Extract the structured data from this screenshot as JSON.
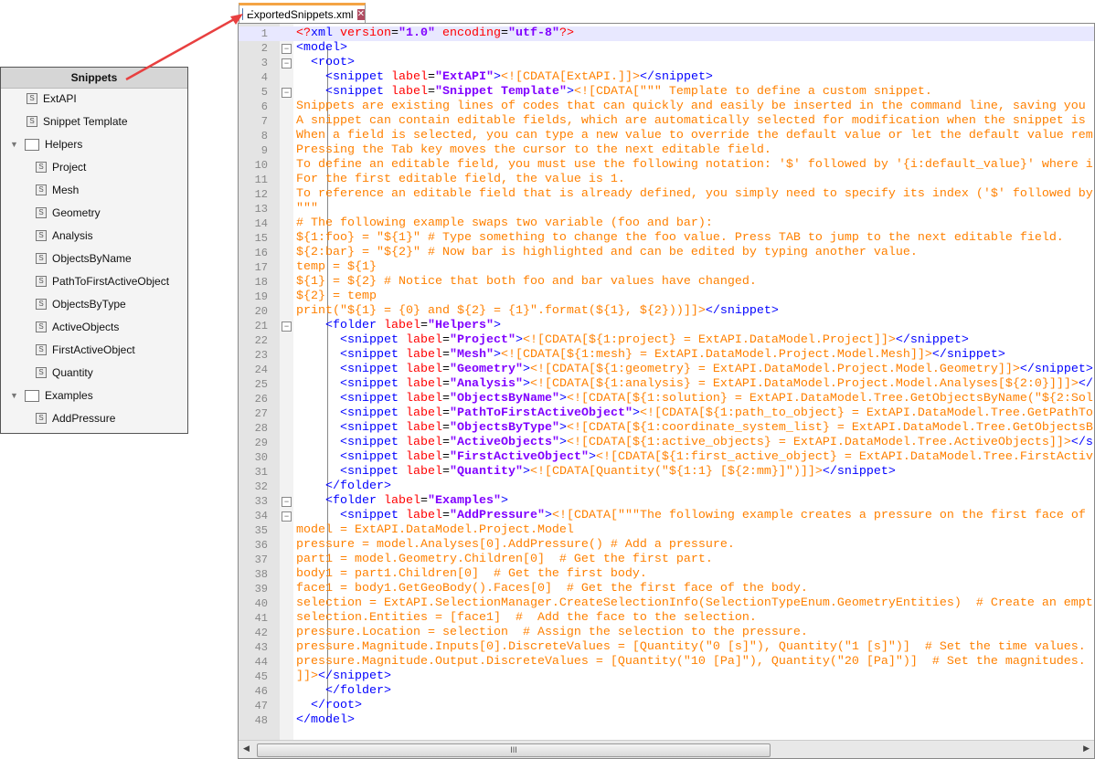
{
  "tree": {
    "title": "Snippets",
    "items": [
      {
        "label": "ExtAPI",
        "type": "snippet",
        "level": 1
      },
      {
        "label": "Snippet Template",
        "type": "snippet",
        "level": 1
      },
      {
        "label": "Helpers",
        "type": "folder",
        "level": 0
      },
      {
        "label": "Project",
        "type": "snippet",
        "level": 2
      },
      {
        "label": "Mesh",
        "type": "snippet",
        "level": 2
      },
      {
        "label": "Geometry",
        "type": "snippet",
        "level": 2
      },
      {
        "label": "Analysis",
        "type": "snippet",
        "level": 2
      },
      {
        "label": "ObjectsByName",
        "type": "snippet",
        "level": 2
      },
      {
        "label": "PathToFirstActiveObject",
        "type": "snippet",
        "level": 2
      },
      {
        "label": "ObjectsByType",
        "type": "snippet",
        "level": 2
      },
      {
        "label": "ActiveObjects",
        "type": "snippet",
        "level": 2
      },
      {
        "label": "FirstActiveObject",
        "type": "snippet",
        "level": 2
      },
      {
        "label": "Quantity",
        "type": "snippet",
        "level": 2
      },
      {
        "label": "Examples",
        "type": "folder",
        "level": 0
      },
      {
        "label": "AddPressure",
        "type": "snippet",
        "level": 2
      }
    ],
    "snippet_icon_letter": "S"
  },
  "tab": {
    "label": "ExportedSnippets.xml",
    "close": "✕"
  },
  "scroll_grip": "III",
  "code_lines": [
    [
      [
        "pi",
        "<?"
      ],
      [
        "tag",
        "xml "
      ],
      [
        "attr",
        "version"
      ],
      [
        "eq",
        "="
      ],
      [
        "val",
        "\"1.0\" "
      ],
      [
        "attr",
        "encoding"
      ],
      [
        "eq",
        "="
      ],
      [
        "val",
        "\"utf-8\""
      ],
      [
        "pi",
        "?>"
      ]
    ],
    [
      [
        "tag",
        "<model>"
      ]
    ],
    [
      [
        "tag",
        "  <root>"
      ]
    ],
    [
      [
        "tag",
        "    <snippet "
      ],
      [
        "attr",
        "label"
      ],
      [
        "eq",
        "="
      ],
      [
        "val",
        "\"ExtAPI\""
      ],
      [
        "tag",
        ">"
      ],
      [
        "cd",
        "<![CDATA[ExtAPI.]]>"
      ],
      [
        "tag",
        "</snippet>"
      ]
    ],
    [
      [
        "tag",
        "    <snippet "
      ],
      [
        "attr",
        "label"
      ],
      [
        "eq",
        "="
      ],
      [
        "val",
        "\"Snippet Template\""
      ],
      [
        "tag",
        ">"
      ],
      [
        "cd",
        "<![CDATA[\"\"\" Template to define a custom snippet."
      ]
    ],
    [
      [
        "cd",
        "Snippets are existing lines of codes that can quickly and easily be inserted in the command line, saving you"
      ]
    ],
    [
      [
        "cd",
        "A snippet can contain editable fields, which are automatically selected for modification when the snippet is"
      ]
    ],
    [
      [
        "cd",
        "When a field is selected, you can type a new value to override the default value or let the default value rem"
      ]
    ],
    [
      [
        "cd",
        "Pressing the Tab key moves the cursor to the next editable field."
      ]
    ],
    [
      [
        "cd",
        "To define an editable field, you must use the following notation: '$' followed by '{i:default_value}' where i"
      ]
    ],
    [
      [
        "cd",
        "For the first editable field, the value is 1."
      ]
    ],
    [
      [
        "cd",
        "To reference an editable field that is already defined, you simply need to specify its index ('$' followed by"
      ]
    ],
    [
      [
        "cd",
        "\"\"\""
      ]
    ],
    [
      [
        "cd",
        "# The following example swaps two variable (foo and bar):"
      ]
    ],
    [
      [
        "cd",
        "${1:foo} = \"${1}\" # Type something to change the foo value. Press TAB to jump to the next editable field."
      ]
    ],
    [
      [
        "cd",
        "${2:bar} = \"${2}\" # Now bar is highlighted and can be edited by typing another value."
      ]
    ],
    [
      [
        "cd",
        "temp = ${1}"
      ]
    ],
    [
      [
        "cd",
        "${1} = ${2} # Notice that both foo and bar values have changed."
      ]
    ],
    [
      [
        "cd",
        "${2} = temp"
      ]
    ],
    [
      [
        "cd",
        "print(\"${1} = {0} and ${2} = {1}\".format(${1}, ${2}))]]>"
      ],
      [
        "tag",
        "</snippet>"
      ]
    ],
    [
      [
        "tag",
        "    <folder "
      ],
      [
        "attr",
        "label"
      ],
      [
        "eq",
        "="
      ],
      [
        "val",
        "\"Helpers\""
      ],
      [
        "tag",
        ">"
      ]
    ],
    [
      [
        "tag",
        "      <snippet "
      ],
      [
        "attr",
        "label"
      ],
      [
        "eq",
        "="
      ],
      [
        "val",
        "\"Project\""
      ],
      [
        "tag",
        ">"
      ],
      [
        "cd",
        "<![CDATA[${1:project} = ExtAPI.DataModel.Project]]>"
      ],
      [
        "tag",
        "</snippet>"
      ]
    ],
    [
      [
        "tag",
        "      <snippet "
      ],
      [
        "attr",
        "label"
      ],
      [
        "eq",
        "="
      ],
      [
        "val",
        "\"Mesh\""
      ],
      [
        "tag",
        ">"
      ],
      [
        "cd",
        "<![CDATA[${1:mesh} = ExtAPI.DataModel.Project.Model.Mesh]]>"
      ],
      [
        "tag",
        "</snippet>"
      ]
    ],
    [
      [
        "tag",
        "      <snippet "
      ],
      [
        "attr",
        "label"
      ],
      [
        "eq",
        "="
      ],
      [
        "val",
        "\"Geometry\""
      ],
      [
        "tag",
        ">"
      ],
      [
        "cd",
        "<![CDATA[${1:geometry} = ExtAPI.DataModel.Project.Model.Geometry]]>"
      ],
      [
        "tag",
        "</snippet>"
      ]
    ],
    [
      [
        "tag",
        "      <snippet "
      ],
      [
        "attr",
        "label"
      ],
      [
        "eq",
        "="
      ],
      [
        "val",
        "\"Analysis\""
      ],
      [
        "tag",
        ">"
      ],
      [
        "cd",
        "<![CDATA[${1:analysis} = ExtAPI.DataModel.Project.Model.Analyses[${2:0}]]]>"
      ],
      [
        "tag",
        "</snippet>"
      ]
    ],
    [
      [
        "tag",
        "      <snippet "
      ],
      [
        "attr",
        "label"
      ],
      [
        "eq",
        "="
      ],
      [
        "val",
        "\"ObjectsByName\""
      ],
      [
        "tag",
        ">"
      ],
      [
        "cd",
        "<![CDATA[${1:solution} = ExtAPI.DataModel.Tree.GetObjectsByName(\"${2:Sol"
      ]
    ],
    [
      [
        "tag",
        "      <snippet "
      ],
      [
        "attr",
        "label"
      ],
      [
        "eq",
        "="
      ],
      [
        "val",
        "\"PathToFirstActiveObject\""
      ],
      [
        "tag",
        ">"
      ],
      [
        "cd",
        "<![CDATA[${1:path_to_object} = ExtAPI.DataModel.Tree.GetPathTo"
      ]
    ],
    [
      [
        "tag",
        "      <snippet "
      ],
      [
        "attr",
        "label"
      ],
      [
        "eq",
        "="
      ],
      [
        "val",
        "\"ObjectsByType\""
      ],
      [
        "tag",
        ">"
      ],
      [
        "cd",
        "<![CDATA[${1:coordinate_system_list} = ExtAPI.DataModel.Tree.GetObjectsB"
      ]
    ],
    [
      [
        "tag",
        "      <snippet "
      ],
      [
        "attr",
        "label"
      ],
      [
        "eq",
        "="
      ],
      [
        "val",
        "\"ActiveObjects\""
      ],
      [
        "tag",
        ">"
      ],
      [
        "cd",
        "<![CDATA[${1:active_objects} = ExtAPI.DataModel.Tree.ActiveObjects]]>"
      ],
      [
        "tag",
        "</snippet>"
      ]
    ],
    [
      [
        "tag",
        "      <snippet "
      ],
      [
        "attr",
        "label"
      ],
      [
        "eq",
        "="
      ],
      [
        "val",
        "\"FirstActiveObject\""
      ],
      [
        "tag",
        ">"
      ],
      [
        "cd",
        "<![CDATA[${1:first_active_object} = ExtAPI.DataModel.Tree.FirstActiv"
      ]
    ],
    [
      [
        "tag",
        "      <snippet "
      ],
      [
        "attr",
        "label"
      ],
      [
        "eq",
        "="
      ],
      [
        "val",
        "\"Quantity\""
      ],
      [
        "tag",
        ">"
      ],
      [
        "cd",
        "<![CDATA[Quantity(\"${1:1} [${2:mm}]\")]]>"
      ],
      [
        "tag",
        "</snippet>"
      ]
    ],
    [
      [
        "tag",
        "    </folder>"
      ]
    ],
    [
      [
        "tag",
        "    <folder "
      ],
      [
        "attr",
        "label"
      ],
      [
        "eq",
        "="
      ],
      [
        "val",
        "\"Examples\""
      ],
      [
        "tag",
        ">"
      ]
    ],
    [
      [
        "tag",
        "      <snippet "
      ],
      [
        "attr",
        "label"
      ],
      [
        "eq",
        "="
      ],
      [
        "val",
        "\"AddPressure\""
      ],
      [
        "tag",
        ">"
      ],
      [
        "cd",
        "<![CDATA[\"\"\"The following example creates a pressure on the first face of"
      ]
    ],
    [
      [
        "cd",
        "model = ExtAPI.DataModel.Project.Model"
      ]
    ],
    [
      [
        "cd",
        "pressure = model.Analyses[0].AddPressure() # Add a pressure."
      ]
    ],
    [
      [
        "cd",
        "part1 = model.Geometry.Children[0]  # Get the first part."
      ]
    ],
    [
      [
        "cd",
        "body1 = part1.Children[0]  # Get the first body."
      ]
    ],
    [
      [
        "cd",
        "face1 = body1.GetGeoBody().Faces[0]  # Get the first face of the body."
      ]
    ],
    [
      [
        "cd",
        "selection = ExtAPI.SelectionManager.CreateSelectionInfo(SelectionTypeEnum.GeometryEntities)  # Create an empt"
      ]
    ],
    [
      [
        "cd",
        "selection.Entities = [face1]  #  Add the face to the selection."
      ]
    ],
    [
      [
        "cd",
        "pressure.Location = selection  # Assign the selection to the pressure."
      ]
    ],
    [
      [
        "cd",
        "pressure.Magnitude.Inputs[0].DiscreteValues = [Quantity(\"0 [s]\"), Quantity(\"1 [s]\")]  # Set the time values."
      ]
    ],
    [
      [
        "cd",
        "pressure.Magnitude.Output.DiscreteValues = [Quantity(\"10 [Pa]\"), Quantity(\"20 [Pa]\")]  # Set the magnitudes."
      ]
    ],
    [
      [
        "cd",
        "]]>"
      ],
      [
        "tag",
        "</snippet>"
      ]
    ],
    [
      [
        "tag",
        "    </folder>"
      ]
    ],
    [
      [
        "tag",
        "  </root>"
      ]
    ],
    [
      [
        "tag",
        "</model>"
      ]
    ]
  ],
  "fold_lines": [
    2,
    3,
    5,
    21,
    33,
    34
  ],
  "colors": {
    "tag": "#0000ff",
    "attr": "#ff0000",
    "value": "#8000ff",
    "cdata": "#ff8000",
    "arrow": "#e84040",
    "tab_accent": "#f4a444"
  }
}
